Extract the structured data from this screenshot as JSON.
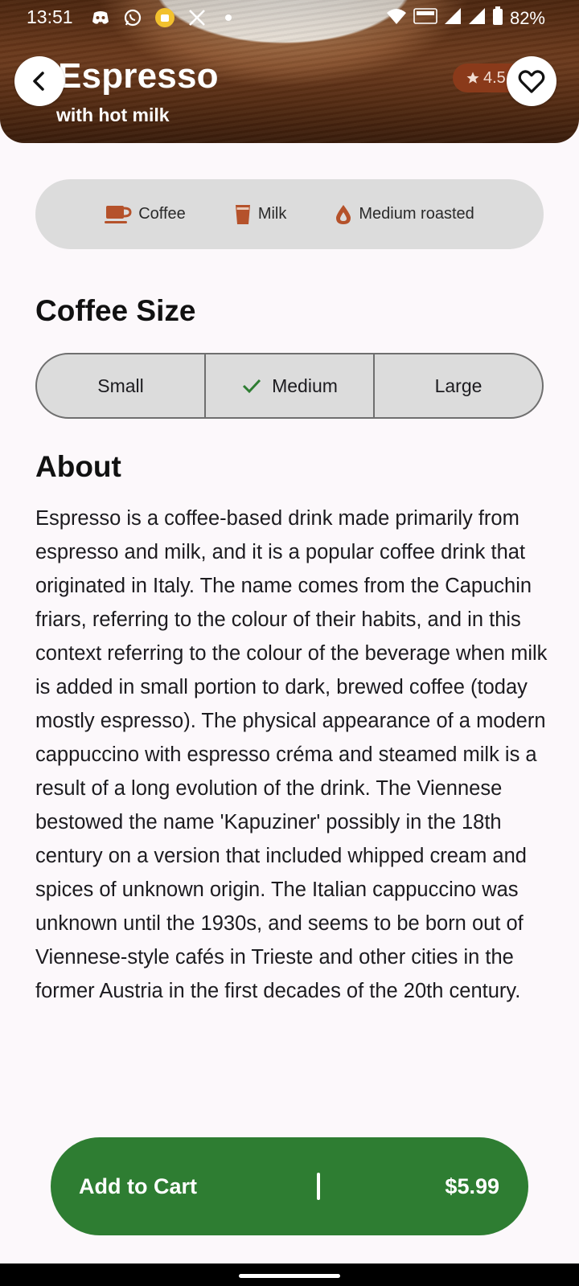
{
  "status_bar": {
    "time": "13:51",
    "battery": "82%",
    "icons": [
      "discord-icon",
      "whatsapp-icon",
      "app-icon",
      "x-icon",
      "dot-icon",
      "wifi-icon",
      "volte-icon",
      "signal-icon",
      "signal-icon",
      "battery-icon"
    ]
  },
  "header": {
    "title": "Espresso",
    "subtitle": "with hot milk",
    "rating": "4.5"
  },
  "attributes": [
    {
      "label": "Coffee",
      "icon": "coffee-cup-icon"
    },
    {
      "label": "Milk",
      "icon": "milk-glass-icon"
    },
    {
      "label": "Medium roasted",
      "icon": "drop-icon"
    }
  ],
  "size": {
    "title": "Coffee Size",
    "options": [
      "Small",
      "Medium",
      "Large"
    ],
    "selected": "Medium"
  },
  "about": {
    "title": "About",
    "text": "Espresso is a coffee-based drink made primarily from espresso and milk, and it is a popular coffee drink that originated in Italy. The name comes from the Capuchin friars, referring to the colour of their habits, and in this context referring to the colour of the beverage when milk is added in small portion to dark, brewed coffee (today mostly espresso). The physical appearance of a modern cappuccino with espresso créma and steamed milk is a result of a long evolution of the drink. The Viennese bestowed the name 'Kapuziner' possibly in the 18th century on a version that included whipped cream and spices of unknown origin. The Italian cappuccino was unknown until the 1930s, and seems to be born out of Viennese-style cafés in Trieste and other cities in the former Austria in the first decades of the 20th century."
  },
  "cart": {
    "label": "Add to Cart",
    "price": "$5.99"
  },
  "colors": {
    "accent_green": "#2e7d32",
    "icon_brown": "#b5522b",
    "rating_bg": "#8a3a1a"
  }
}
